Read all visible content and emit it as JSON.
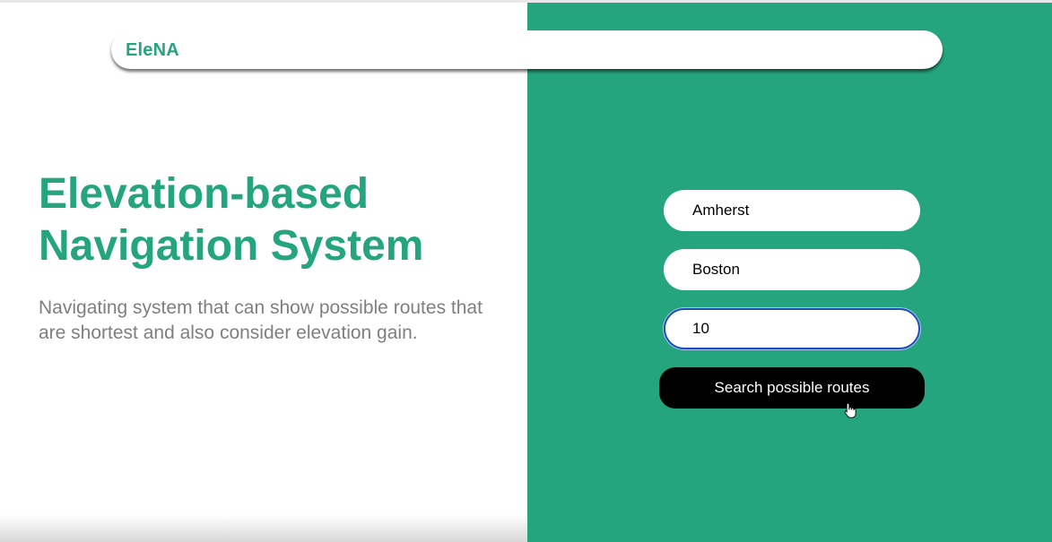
{
  "header": {
    "brand": "EleNA"
  },
  "hero": {
    "title_line1": "Elevation-based",
    "title_line2": "Navigation System",
    "subtitle": "Navigating system that can show possible routes that are shortest and also consider elevation gain."
  },
  "form": {
    "origin_value": "Amherst",
    "destination_value": "Boston",
    "percentage_value": "10",
    "submit_label": "Search possible routes"
  },
  "colors": {
    "accent": "#24a57e",
    "button": "#000000",
    "subtitle_text": "#7f7f7f",
    "focus_ring": "#1d4fb8"
  },
  "icons": {
    "pointer": "hand-pointer-icon"
  }
}
